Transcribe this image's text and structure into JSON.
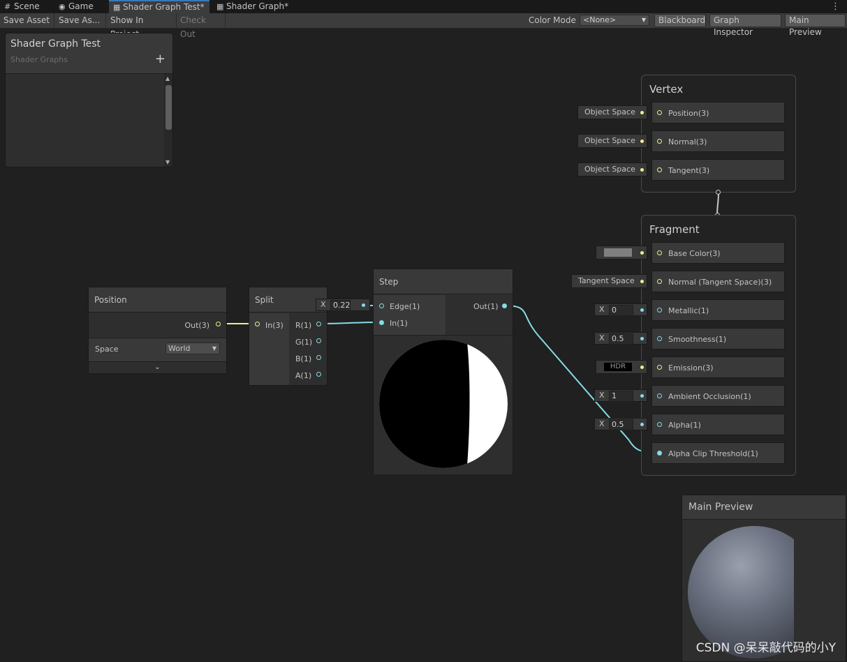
{
  "tabs": [
    {
      "label": "Scene",
      "icon": "grid-icon"
    },
    {
      "label": "Game",
      "icon": "gamepad-icon"
    },
    {
      "label": "Shader Graph Test*",
      "icon": "shader-graph-icon"
    },
    {
      "label": "Shader Graph*",
      "icon": "shader-graph-icon"
    }
  ],
  "toolbar": {
    "save_asset": "Save Asset",
    "save_as": "Save As...",
    "show_in_project": "Show In Project",
    "check_out": "Check Out",
    "color_mode_label": "Color Mode",
    "color_mode_value": "<None>",
    "blackboard": "Blackboard",
    "graph_inspector": "Graph Inspector",
    "main_preview": "Main Preview"
  },
  "blackboard": {
    "title": "Shader Graph Test",
    "subtitle": "Shader Graphs",
    "add_symbol": "+"
  },
  "position_node": {
    "title": "Position",
    "out_label": "Out(3)",
    "space_label": "Space",
    "space_value": "World"
  },
  "split_node": {
    "title": "Split",
    "in_label": "In(3)",
    "outputs": [
      "R(1)",
      "G(1)",
      "B(1)",
      "A(1)"
    ]
  },
  "step_node": {
    "title": "Step",
    "edge_label": "Edge(1)",
    "in_label": "In(1)",
    "out_label": "Out(1)",
    "edge_x_label": "X",
    "edge_value": "0.22"
  },
  "vertex": {
    "title": "Vertex",
    "blocks": [
      {
        "label": "Position(3)",
        "input": "Object Space"
      },
      {
        "label": "Normal(3)",
        "input": "Object Space"
      },
      {
        "label": "Tangent(3)",
        "input": "Object Space"
      }
    ]
  },
  "fragment": {
    "title": "Fragment",
    "base_color": {
      "label": "Base Color(3)",
      "swatch": "#7f7f7f"
    },
    "normal": {
      "label": "Normal (Tangent Space)(3)",
      "input": "Tangent Space"
    },
    "metallic": {
      "label": "Metallic(1)",
      "x": "X",
      "value": "0"
    },
    "smoothness": {
      "label": "Smoothness(1)",
      "x": "X",
      "value": "0.5"
    },
    "emission": {
      "label": "Emission(3)",
      "input": "HDR"
    },
    "ambient_occlusion": {
      "label": "Ambient Occlusion(1)",
      "x": "X",
      "value": "1"
    },
    "alpha": {
      "label": "Alpha(1)",
      "x": "X",
      "value": "0.5"
    },
    "alpha_clip": {
      "label": "Alpha Clip Threshold(1)"
    }
  },
  "main_preview": {
    "title": "Main Preview"
  },
  "watermark": "CSDN @呆呆敲代码的小Y",
  "colors": {
    "vector3_port": "#f2ec8f",
    "float_port": "#86dbe6",
    "tab_accent": "#3a79bb"
  }
}
